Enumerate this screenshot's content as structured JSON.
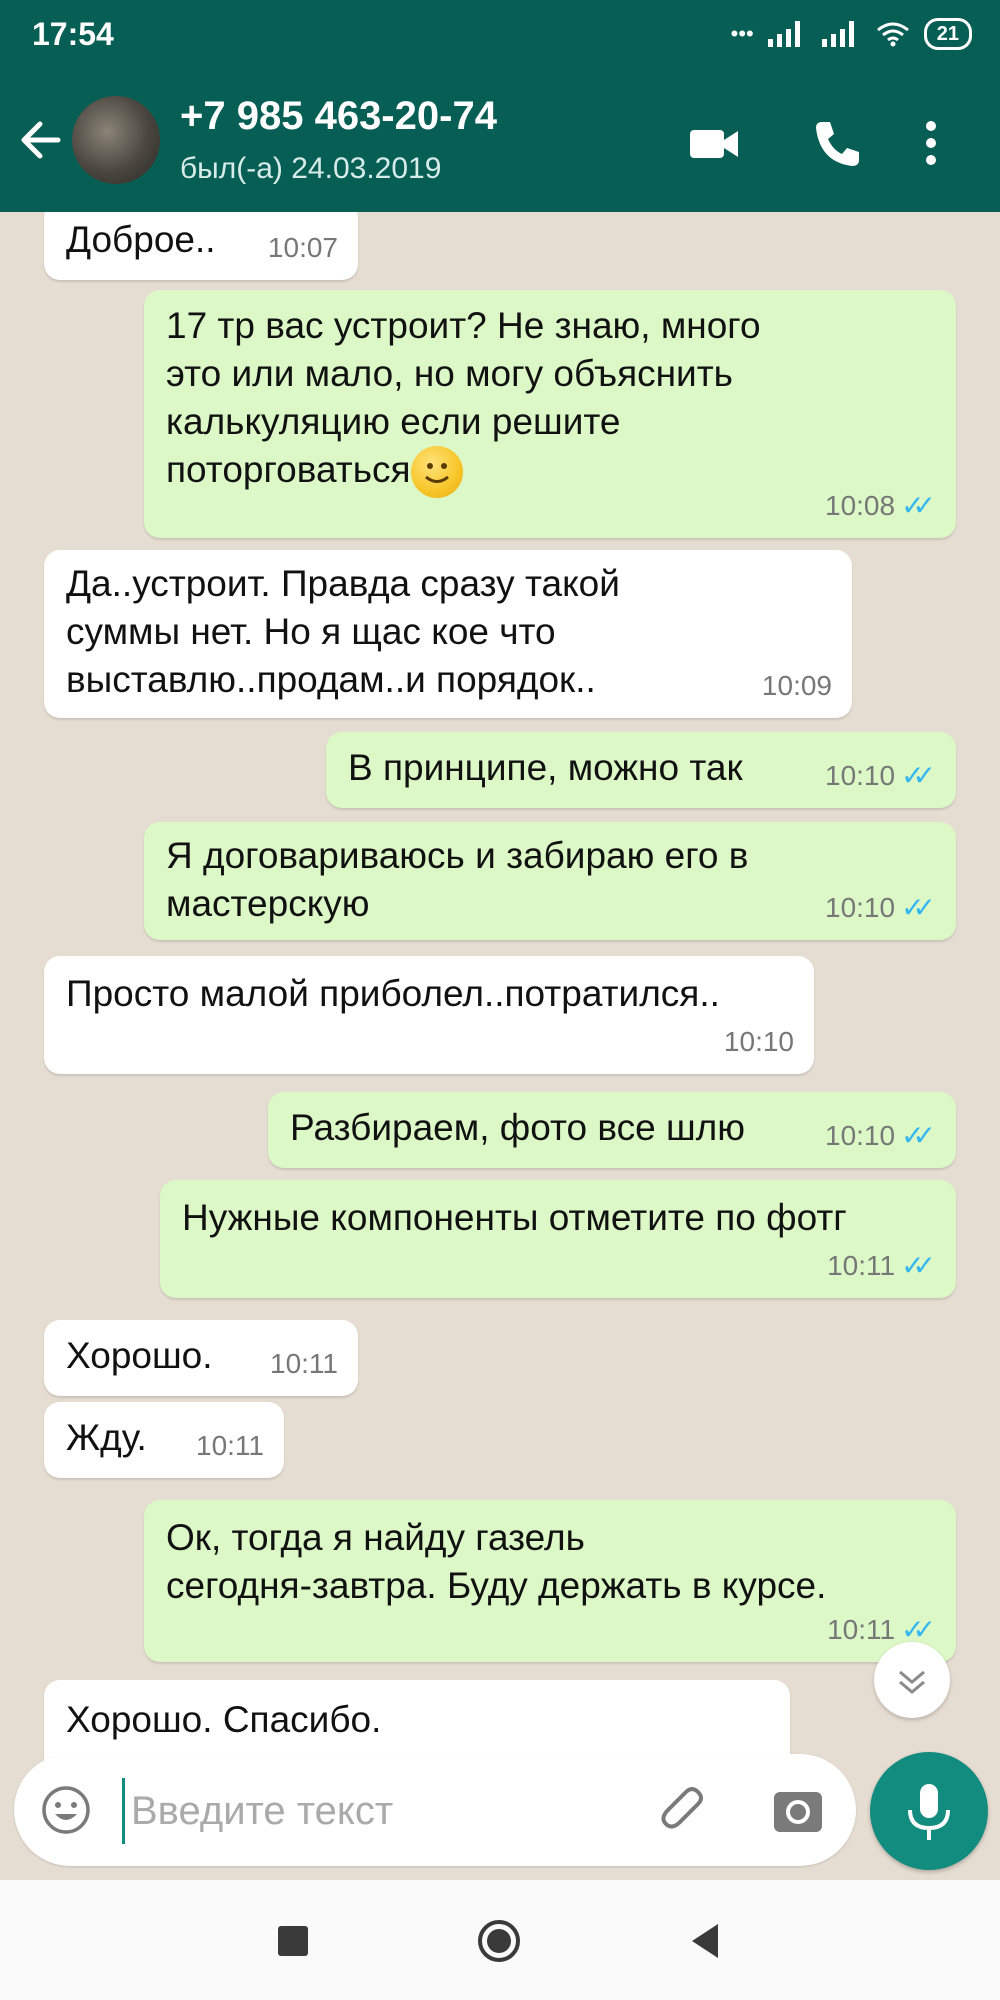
{
  "status_bar": {
    "time": "17:54",
    "battery": "21"
  },
  "header": {
    "contact_name": "+7 985 463-20-74",
    "last_seen": "был(-а) 24.03.2019",
    "icons": [
      "back-arrow-icon",
      "video-call-icon",
      "phone-icon",
      "more-vert-icon"
    ]
  },
  "messages": [
    {
      "direction": "in",
      "lines": [
        "Доброе.."
      ],
      "time": "10:07"
    },
    {
      "direction": "out",
      "lines": [
        "17 тр вас устроит? Не знаю, много",
        "это или мало, но могу объяснить",
        "калькуляцию если решите",
        "поторговаться"
      ],
      "emoji": "slightly-smiling-face",
      "time": "10:08",
      "read": true
    },
    {
      "direction": "in",
      "lines": [
        "Да..устроит. Правда сразу такой",
        "суммы нет. Но я щас кое что",
        "выставлю..продам..и порядок.."
      ],
      "time": "10:09"
    },
    {
      "direction": "out",
      "lines": [
        "В принципе, можно так"
      ],
      "time": "10:10",
      "read": true
    },
    {
      "direction": "out",
      "lines": [
        "Я договариваюсь и забираю его в",
        "мастерскую"
      ],
      "time": "10:10",
      "read": true
    },
    {
      "direction": "in",
      "lines": [
        "Просто малой приболел..потратился.."
      ],
      "time": "10:10"
    },
    {
      "direction": "out",
      "lines": [
        "Разбираем, фото все шлю"
      ],
      "time": "10:10",
      "read": true
    },
    {
      "direction": "out",
      "lines": [
        "Нужные компоненты отметите по фотг"
      ],
      "time": "10:11",
      "read": true
    },
    {
      "direction": "in",
      "lines": [
        "Хорошо."
      ],
      "time": "10:11"
    },
    {
      "direction": "in",
      "lines": [
        "Жду."
      ],
      "time": "10:11"
    },
    {
      "direction": "out",
      "lines": [
        "Ок, тогда я найду газель",
        "сегодня-завтра. Буду держать в курсе."
      ],
      "time": "10:11",
      "read": true
    },
    {
      "direction": "in",
      "lines": [
        "Хорошо. Спасибо."
      ],
      "time": ""
    }
  ],
  "input": {
    "placeholder": "Введите текст",
    "value": ""
  },
  "colors": {
    "header": "#075e54",
    "outgoing": "#dcf8c6",
    "incoming": "#ffffff",
    "accent": "#128c7e",
    "read_ticks": "#34b7f1"
  }
}
